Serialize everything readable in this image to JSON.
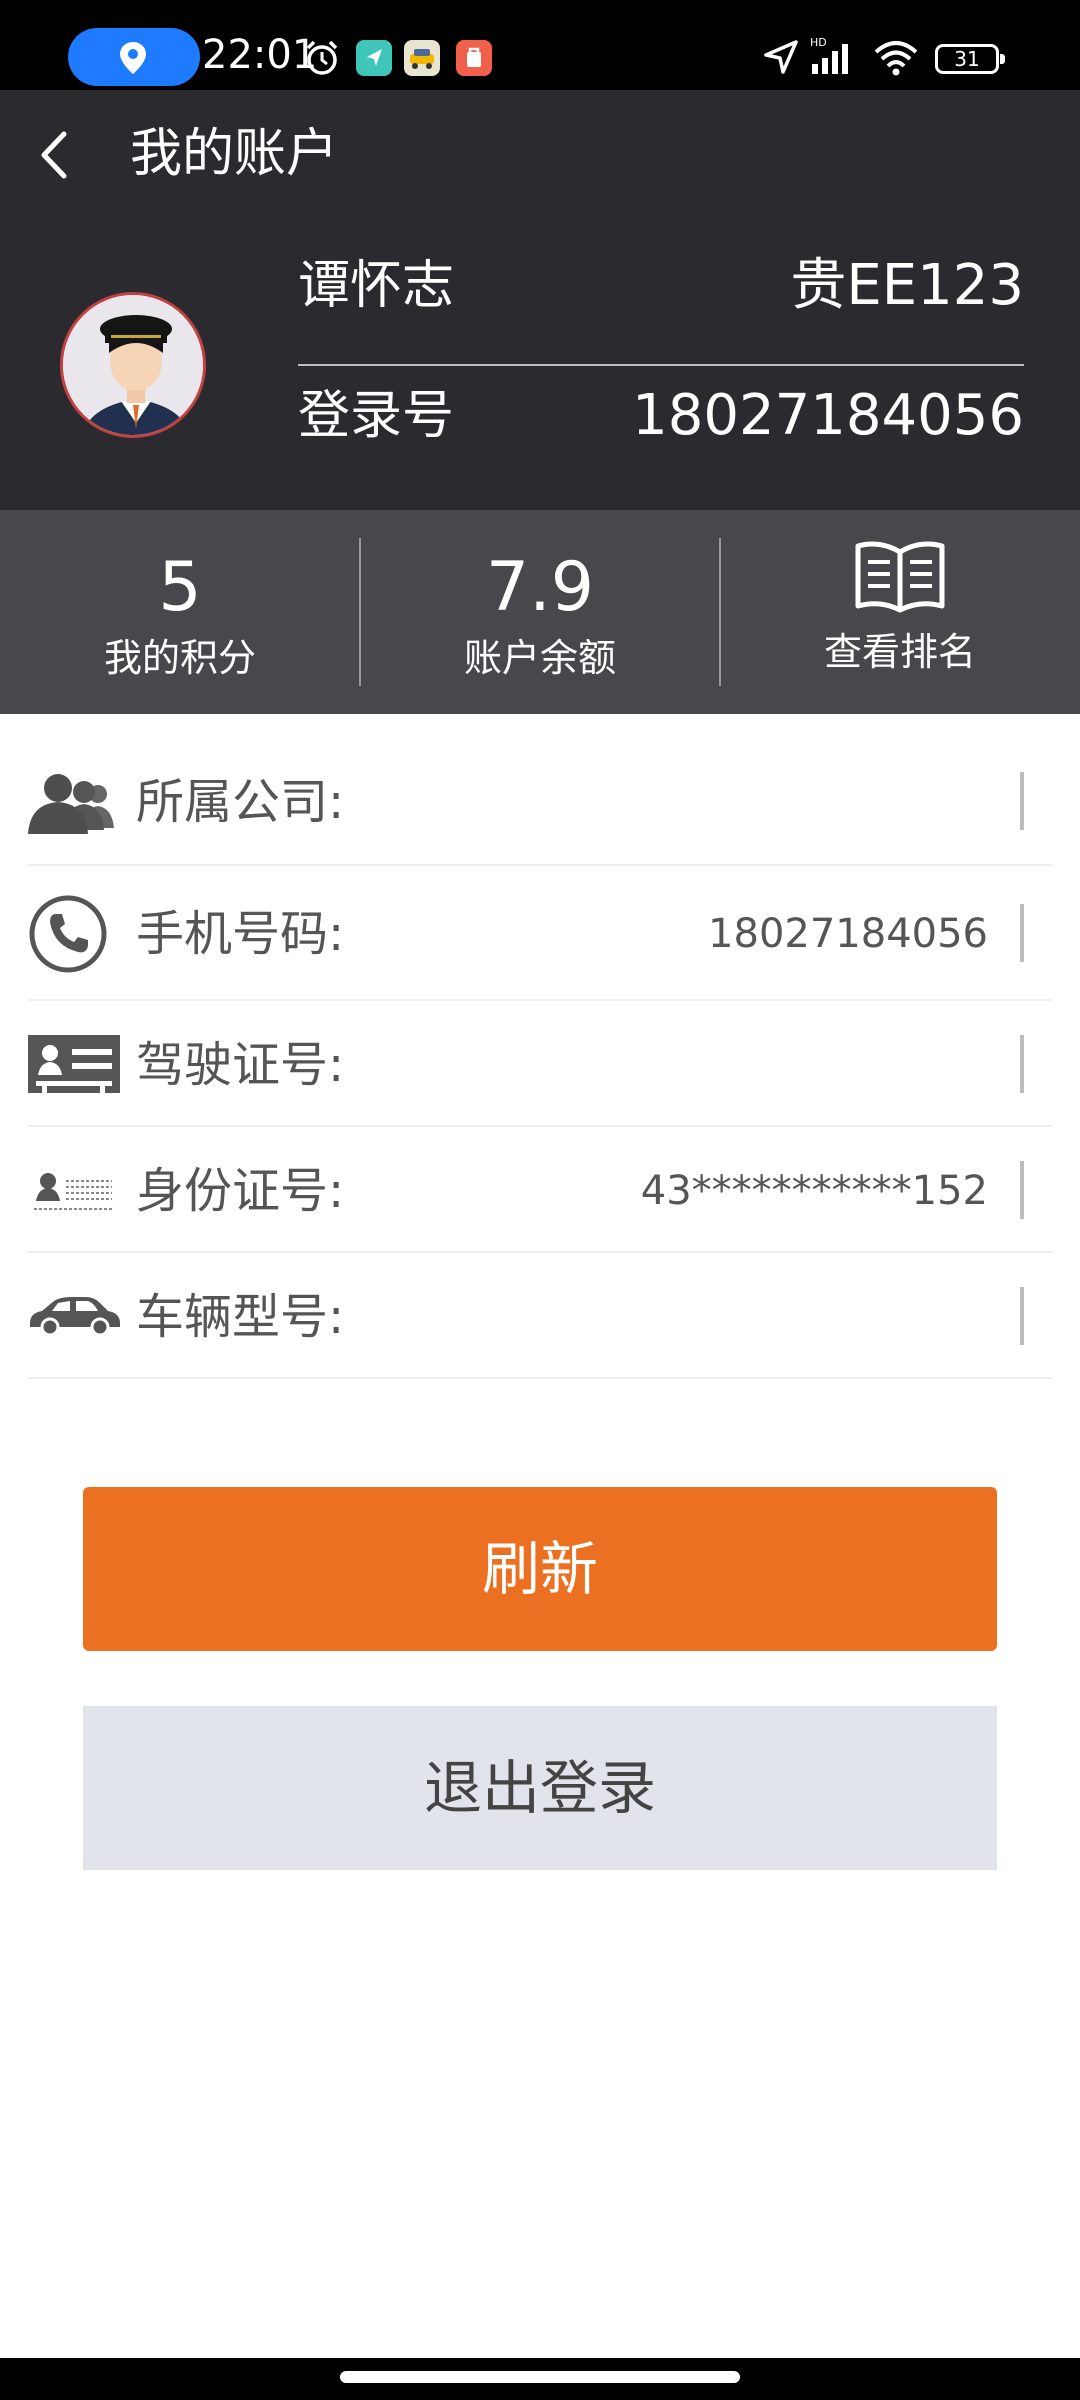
{
  "status_bar": {
    "time": "22:01",
    "battery": "31",
    "icons": [
      "location-pill-icon",
      "alarm-icon",
      "navigation-app-icon",
      "taxi-app-icon",
      "store-app-icon",
      "location-arrow-icon",
      "hd-signal-icon",
      "wifi-icon",
      "battery-icon"
    ]
  },
  "header": {
    "title": "我的账户",
    "back_icon": "chevron-left-icon"
  },
  "profile": {
    "name": "谭怀志",
    "plate": "贵EE123",
    "login_label": "登录号",
    "login_value": "18027184056",
    "avatar_icon": "driver-avatar"
  },
  "stats": [
    {
      "value": "5",
      "label": "我的积分"
    },
    {
      "value": "7.9",
      "label": "账户余额"
    },
    {
      "label": "查看排名",
      "icon": "book-icon"
    }
  ],
  "info": [
    {
      "label": "所属公司:",
      "value": "",
      "icon": "group-icon"
    },
    {
      "label": "手机号码:",
      "value": "18027184056",
      "icon": "phone-icon"
    },
    {
      "label": "驾驶证号:",
      "value": "",
      "icon": "license-card-icon"
    },
    {
      "label": "身份证号:",
      "value": "43***********152",
      "icon": "id-card-icon"
    },
    {
      "label": "车辆型号:",
      "value": "",
      "icon": "car-icon"
    }
  ],
  "buttons": {
    "refresh": "刷新",
    "logout": "退出登录"
  },
  "colors": {
    "header_bg": "#2b2b2f",
    "stats_bg": "#48484c",
    "accent": "#ec7022",
    "logout_bg": "#e1e4ea"
  }
}
